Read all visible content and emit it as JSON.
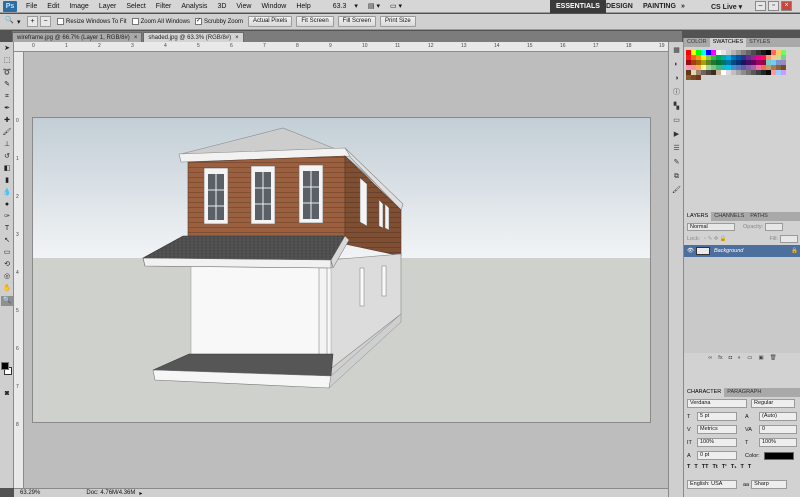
{
  "app": {
    "logo": "Ps"
  },
  "menu": [
    "File",
    "Edit",
    "Image",
    "Layer",
    "Select",
    "Filter",
    "Analysis",
    "3D",
    "View",
    "Window",
    "Help"
  ],
  "menu_zoom": "63.3",
  "workspaces": {
    "essentials": "ESSENTIALS",
    "design": "DESIGN",
    "painting": "PAINTING",
    "more": "»",
    "cslive": "CS Live ▾"
  },
  "window_buttons": {
    "minimize": "–",
    "restore": "▫",
    "close": "×"
  },
  "options": {
    "resize_windows": "Resize Windows To Fit",
    "zoom_all": "Zoom All Windows",
    "scrubby": "Scrubby Zoom",
    "actual_pixels": "Actual Pixels",
    "fit_screen": "Fit Screen",
    "fill_screen": "Fill Screen",
    "print_size": "Print Size"
  },
  "tabs": [
    {
      "label": "wireframe.jpg @ 66.7% (Layer 1, RGB/8#)",
      "close": "×"
    },
    {
      "label": "shaded.jpg @ 63.3% (RGB/8#)",
      "close": "×"
    }
  ],
  "ruler_top": [
    "0",
    "1",
    "2",
    "3",
    "4",
    "5",
    "6",
    "7",
    "8",
    "9",
    "10",
    "11",
    "12",
    "13",
    "14",
    "15",
    "16",
    "17",
    "18",
    "19"
  ],
  "ruler_left": [
    "0",
    "1",
    "2",
    "3",
    "4",
    "5",
    "6",
    "7",
    "8"
  ],
  "status": {
    "zoom": "63.29%",
    "doc": "Doc: 4.76M/4.36M"
  },
  "panel": {
    "swatch_tabs": [
      "COLOR",
      "SWATCHES",
      "STYLES"
    ],
    "layer_tabs": [
      "LAYERS",
      "CHANNELS",
      "PATHS"
    ],
    "blend_mode": "Normal",
    "opacity_label": "Opacity:",
    "lock_label": "Lock:",
    "fill_label": "Fill:",
    "layer_name": "Background",
    "char_tabs": [
      "CHARACTER",
      "PARAGRAPH"
    ],
    "font_family": "Verdana",
    "font_style": "Regular",
    "font_size": "5 pt",
    "leading": "(Auto)",
    "kerning": "Metrics",
    "tracking": "0",
    "vscale": "100%",
    "hscale": "100%",
    "baseline": "0 pt",
    "color_label": "Color:",
    "language": "English: USA",
    "antialias": "Sharp"
  },
  "colors": {
    "swatches": [
      "#ff0000",
      "#ffff00",
      "#00ff00",
      "#00ffff",
      "#0000ff",
      "#ff00ff",
      "#ffffff",
      "#e6e6e6",
      "#cccccc",
      "#b3b3b3",
      "#999999",
      "#808080",
      "#666666",
      "#4d4d4d",
      "#333333",
      "#1a1a1a",
      "#000000",
      "#ff6666",
      "#ffcc66",
      "#66ff66",
      "#ee1c24",
      "#f26522",
      "#f7941d",
      "#fff200",
      "#8dc63f",
      "#39b54a",
      "#00a651",
      "#00a99d",
      "#00aeef",
      "#0072bc",
      "#0054a6",
      "#2e3192",
      "#662d91",
      "#92278f",
      "#ec008c",
      "#ed145b",
      "#f69679",
      "#fdc689",
      "#c4df9b",
      "#82ca9c",
      "#9e0b0f",
      "#a0410d",
      "#a3620a",
      "#aba000",
      "#598527",
      "#197b30",
      "#007236",
      "#00746b",
      "#0076a3",
      "#004b80",
      "#003471",
      "#1b1464",
      "#440e62",
      "#630460",
      "#9e005d",
      "#9e0039",
      "#7accc8",
      "#6dcff6",
      "#8393ca",
      "#a187be",
      "#f49ac1",
      "#f5989d",
      "#fbaf5d",
      "#fff799",
      "#a3d39c",
      "#7cc576",
      "#3cb878",
      "#1abbb4",
      "#00bff3",
      "#448ccb",
      "#5674b9",
      "#605ca8",
      "#855fa8",
      "#a864a8",
      "#f06eaa",
      "#f26c4f",
      "#c69c6d",
      "#a67c52",
      "#8c6239",
      "#754c24",
      "#603913",
      "#e7d4b5",
      "#998675",
      "#736357",
      "#534741",
      "#362f2d",
      "#c7b299",
      "#ffffff",
      "#d9d9d9",
      "#bfbfbf",
      "#a6a6a6",
      "#8c8c8c",
      "#737373",
      "#595959",
      "#404040",
      "#262626",
      "#0d0d0d",
      "#ff9999",
      "#99ccff",
      "#cc99ff",
      "#8b5a2b",
      "#7a4a22",
      "#6b3a18"
    ]
  }
}
